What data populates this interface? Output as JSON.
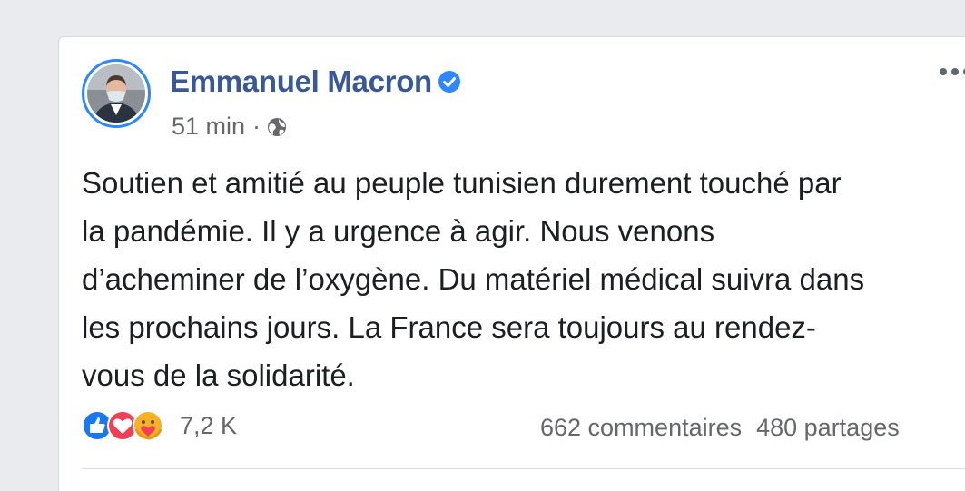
{
  "post": {
    "author": "Emmanuel Macron",
    "verified": true,
    "time": "51 min",
    "separator": "·",
    "privacy_icon": "globe-icon",
    "text_lines": [
      "Soutien et amitié au peuple tunisien durement touché par",
      "la pandémie. Il y a urgence à agir. Nous venons",
      "d’acheminer de l’oxygène. Du matériel médical suivra dans",
      "les prochains jours. La France sera toujours au rendez-",
      "vous de la solidarité."
    ],
    "reactions": {
      "icons": [
        "like-icon",
        "love-icon",
        "care-icon"
      ],
      "count": "7,2 K"
    },
    "comments": "662 commentaires",
    "shares": "480 partages"
  },
  "colors": {
    "author": "#385898",
    "verified": "#2d88ff",
    "secondary_text": "#65676b",
    "like": "#1877f2",
    "love": "#f33e58",
    "care": "#f7b125"
  }
}
